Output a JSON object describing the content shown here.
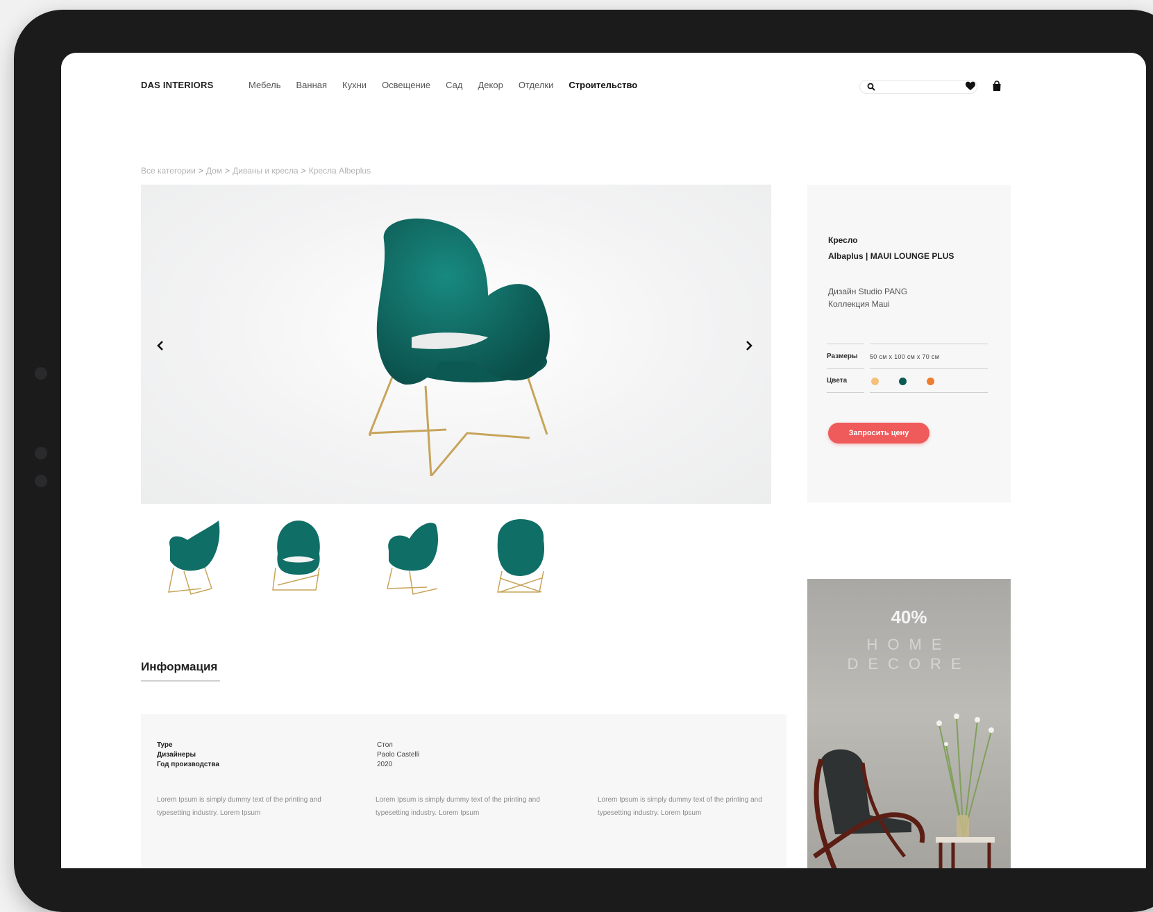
{
  "header": {
    "logo": "DAS INTERIORS",
    "nav": [
      "Мебель",
      "Ванная",
      "Кухни",
      "Освещение",
      "Сад",
      "Декор",
      "Отделки",
      "Строительство"
    ],
    "active_nav": "Строительство",
    "search_placeholder": "",
    "icons": [
      "search-icon",
      "heart-icon",
      "bag-icon"
    ]
  },
  "breadcrumb": [
    "Все категории",
    "Дом",
    "Диваны и кресла",
    "Кресла Albeplus"
  ],
  "breadcrumb_separator": ">",
  "product": {
    "type": "Кресло",
    "name": "Albaplus | MAUI LOUNGE PLUS",
    "designer": "Дизайн Studio PANG",
    "collection": "Коллекция Maui",
    "specs": {
      "size_label": "Размеры",
      "size_value": "50 см x 100 см x 70 см",
      "colors_label": "Цвета",
      "colors": [
        "#f5c07a",
        "#0d5a55",
        "#ef7d2d"
      ]
    },
    "cta_label": "Запросить цену",
    "chair_color": "#0f6e66",
    "leg_color": "#c7a45a"
  },
  "gallery": {
    "prev_icon": "chevron-left-icon",
    "next_icon": "chevron-right-icon",
    "thumbnail_count": 4
  },
  "promo": {
    "percent": "40%",
    "line1": "HOME",
    "line2": "DECORE"
  },
  "information": {
    "title": "Информация",
    "labels": [
      "Type",
      "Дизайнеры",
      "Год производства"
    ],
    "values": [
      "Стол",
      "Paolo Castelli",
      "2020"
    ],
    "lorem": [
      "Lorem Ipsum is simply dummy text of the printing and typesetting industry. Lorem Ipsum",
      "Lorem Ipsum is simply dummy text of the printing and typesetting industry. Lorem Ipsum",
      "Lorem Ipsum is simply dummy text of the printing and typesetting industry. Lorem Ipsum"
    ]
  }
}
